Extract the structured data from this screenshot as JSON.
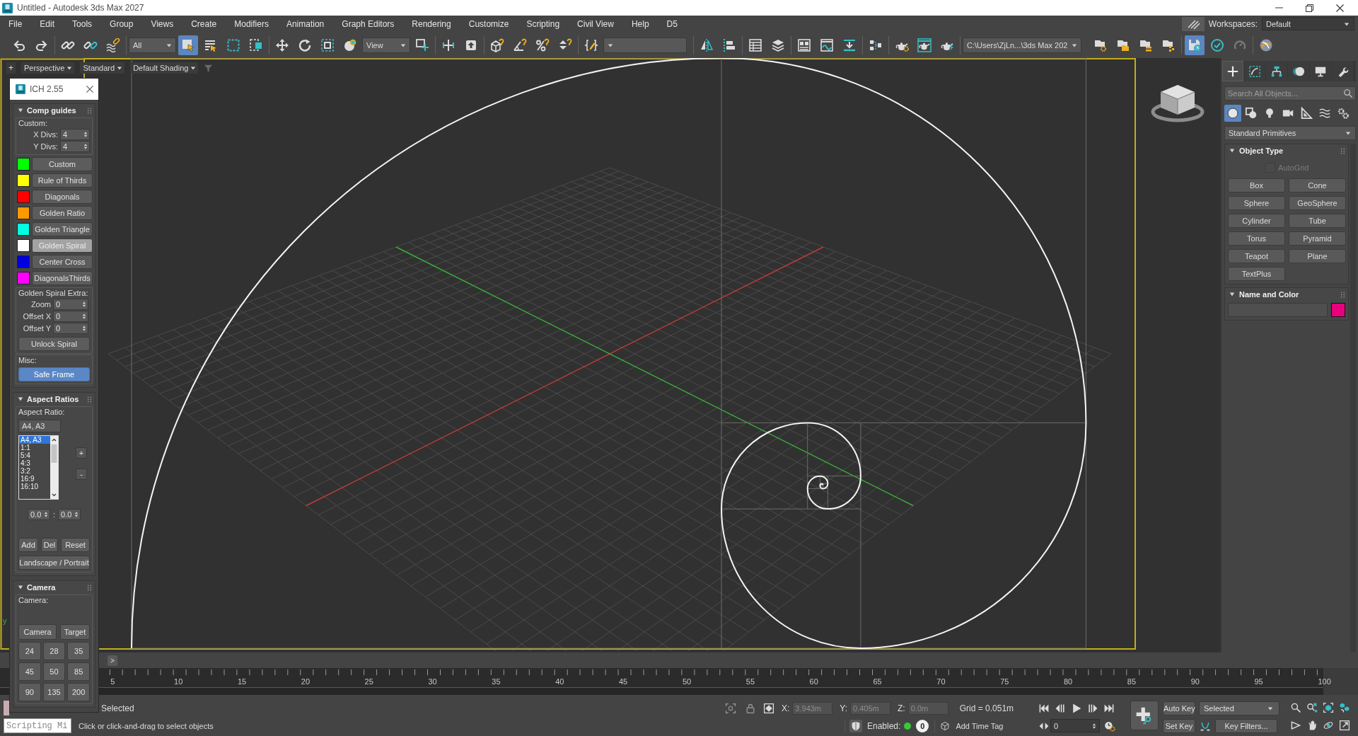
{
  "window": {
    "title": "Untitled - Autodesk 3ds Max 2027"
  },
  "menu": [
    "File",
    "Edit",
    "Tools",
    "Group",
    "Views",
    "Create",
    "Modifiers",
    "Animation",
    "Graph Editors",
    "Rendering",
    "Customize",
    "Scripting",
    "Civil View",
    "Help",
    "D5"
  ],
  "workspaces": {
    "label": "Workspaces:",
    "value": "Default"
  },
  "toolbar": {
    "groups": [
      [
        {
          "kind": "button",
          "on": false
        },
        {
          "kind": "button",
          "on": false
        }
      ],
      [
        {
          "kind": "button",
          "on": false
        },
        {
          "kind": "button",
          "on": false
        },
        {
          "kind": "button",
          "on": false
        }
      ],
      [
        {
          "kind": "dropdown",
          "value": "All"
        },
        {
          "kind": "button",
          "on": true
        },
        {
          "kind": "button",
          "on": false
        },
        {
          "kind": "button",
          "on": false
        },
        {
          "kind": "button",
          "on": false
        }
      ],
      [
        {
          "kind": "button",
          "on": false
        },
        {
          "kind": "button",
          "on": false
        },
        {
          "kind": "button",
          "on": false
        },
        {
          "kind": "button",
          "on": false
        },
        {
          "kind": "dropdown",
          "value": "View"
        },
        {
          "kind": "button",
          "on": false
        }
      ],
      [
        {
          "kind": "button",
          "on": false
        },
        {
          "kind": "button",
          "on": false
        }
      ],
      [
        {
          "kind": "button",
          "on": false
        },
        {
          "kind": "button",
          "on": false
        },
        {
          "kind": "button",
          "on": false
        },
        {
          "kind": "button",
          "on": false
        }
      ],
      [
        {
          "kind": "button",
          "on": false
        },
        {
          "kind": "dropdown"
        }
      ],
      [
        {
          "kind": "button",
          "on": false
        },
        {
          "kind": "button",
          "on": false
        }
      ],
      [
        {
          "kind": "button",
          "on": false
        },
        {
          "kind": "button",
          "on": false
        }
      ],
      [
        {
          "kind": "button",
          "on": false
        },
        {
          "kind": "button",
          "on": false
        },
        {
          "kind": "button",
          "on": false
        }
      ],
      [
        {
          "kind": "button",
          "on": false
        }
      ],
      [
        {
          "kind": "button",
          "on": false
        },
        {
          "kind": "button",
          "on": false
        },
        {
          "kind": "button",
          "on": false
        }
      ],
      [
        {
          "kind": "dropdown",
          "value": "C:\\Users\\ZjLn...\\3ds Max 202"
        },
        {
          "kind": "button",
          "on": false
        },
        {
          "kind": "button",
          "on": false
        },
        {
          "kind": "button",
          "on": false
        },
        {
          "kind": "button",
          "on": false
        }
      ],
      [
        {
          "kind": "button",
          "on": true
        },
        {
          "kind": "button",
          "on": false
        },
        {
          "kind": "button",
          "on": false
        }
      ],
      [
        {
          "kind": "button",
          "on": false
        }
      ]
    ]
  },
  "viewport": {
    "add": "+",
    "menus": [
      "Perspective",
      "Standard",
      "Default Shading"
    ],
    "axis_label": "y"
  },
  "ich": {
    "title": "ICH 2.55",
    "rollouts": [
      {
        "kind": "guides",
        "title": "Comp guides",
        "expanded": true,
        "custom": {
          "title": "Custom:",
          "spinners": [
            {
              "label": "X Divs:",
              "value": "4"
            },
            {
              "label": "Y Divs:",
              "value": "4"
            }
          ]
        },
        "guides": [
          {
            "label": "Custom",
            "color": "#00ff00",
            "on": false
          },
          {
            "label": "Rule of Thirds",
            "color": "#ffff00",
            "on": false
          },
          {
            "label": "Diagonals",
            "color": "#ff0000",
            "on": false
          },
          {
            "label": "Golden Ratio",
            "color": "#ff9900",
            "on": false
          },
          {
            "label": "Golden Triangle",
            "color": "#00ffe1",
            "on": false
          },
          {
            "label": "Golden Spiral",
            "color": "#ffffff",
            "on": true
          },
          {
            "label": "Center Cross",
            "color": "#0000e0",
            "on": false
          },
          {
            "label": "DiagonalsThirds",
            "color": "#ff00ff",
            "on": false
          }
        ],
        "spiral_extra": {
          "title": "Golden Spiral Extra:",
          "spinners": [
            {
              "label": "Zoom",
              "value": "0"
            },
            {
              "label": "Offset X",
              "value": "0"
            },
            {
              "label": "Offset Y",
              "value": "0"
            }
          ],
          "button": "Unlock Spiral"
        },
        "misc": {
          "title": "Misc:",
          "button": {
            "label": "Safe Frame",
            "on": true
          }
        }
      },
      {
        "kind": "aspect",
        "title": "Aspect Ratios",
        "expanded": true,
        "label": "Aspect Ratio:",
        "field": "A4, A3",
        "list": [
          {
            "label": "A4, A3",
            "selected": true
          },
          {
            "label": "1:1",
            "selected": false
          },
          {
            "label": "5:4",
            "selected": false
          },
          {
            "label": "4:3",
            "selected": false
          },
          {
            "label": "3:2",
            "selected": false
          },
          {
            "label": "16:9",
            "selected": false
          },
          {
            "label": "16:10",
            "selected": false
          }
        ],
        "add": "+",
        "remove": "-",
        "size": [
          {
            "value": "0.0"
          },
          {
            "value": "0.0"
          }
        ],
        "separator": ":",
        "buttons": [
          "Add",
          "Del",
          "Reset"
        ],
        "orientation_button": "Landscape / Portrait"
      },
      {
        "kind": "camera",
        "title": "Camera",
        "expanded": true,
        "label": "Camera:",
        "buttons": [
          "Camera",
          "Target"
        ],
        "focal_lengths": [
          "24",
          "28",
          "35",
          "45",
          "50",
          "85",
          "90",
          "135",
          "200"
        ]
      }
    ]
  },
  "command_panel": {
    "tabs": [
      {
        "selected": true
      },
      {
        "selected": false
      },
      {
        "selected": false
      },
      {
        "selected": false
      },
      {
        "selected": false
      },
      {
        "selected": false
      }
    ],
    "search": {
      "placeholder": "Search All Objects..."
    },
    "categories": [
      {
        "selected": true
      },
      {
        "selected": false
      },
      {
        "selected": false
      },
      {
        "selected": false
      },
      {
        "selected": false
      },
      {
        "selected": false
      },
      {
        "selected": false
      }
    ],
    "dropdown": "Standard Primitives",
    "rollouts": [
      {
        "kind": "object_type",
        "title": "Object Type",
        "expanded": true,
        "autogrid": {
          "label": "AutoGrid",
          "checked": false,
          "disabled": true
        },
        "buttons": [
          "Box",
          "Cone",
          "Sphere",
          "GeoSphere",
          "Cylinder",
          "Tube",
          "Torus",
          "Pyramid",
          "Teapot",
          "Plane",
          "TextPlus"
        ]
      },
      {
        "kind": "name_color",
        "title": "Name and Color",
        "expanded": true,
        "color": "#e8007c"
      }
    ]
  },
  "timeline": {
    "next": ">",
    "ticks": [
      "5",
      "10",
      "15",
      "20",
      "25",
      "30",
      "35",
      "40",
      "45",
      "50",
      "55",
      "60",
      "65",
      "70",
      "75",
      "80",
      "85",
      "90",
      "95",
      "100"
    ]
  },
  "status": {
    "listener": {
      "placeholder": "Scripting Mi"
    },
    "selection": "Selected",
    "prompt": "Click or click-and-drag to select objects",
    "coords": [
      {
        "label": "X:",
        "value": "3.943m",
        "disabled": true
      },
      {
        "label": "Y:",
        "value": "0.405m",
        "disabled": true
      },
      {
        "label": "Z:",
        "value": "0.0m",
        "disabled": true
      }
    ],
    "grid": "Grid = 0.051m",
    "time_tags": {
      "label": "Enabled:",
      "enabled": true,
      "count": "0",
      "add": "Add Time Tag"
    },
    "frame": "0",
    "auto_key": {
      "label": "Auto Key",
      "on": false
    },
    "set_key": "Set Key",
    "key_mode": "Selected",
    "key_filters": "Key Filters..."
  }
}
